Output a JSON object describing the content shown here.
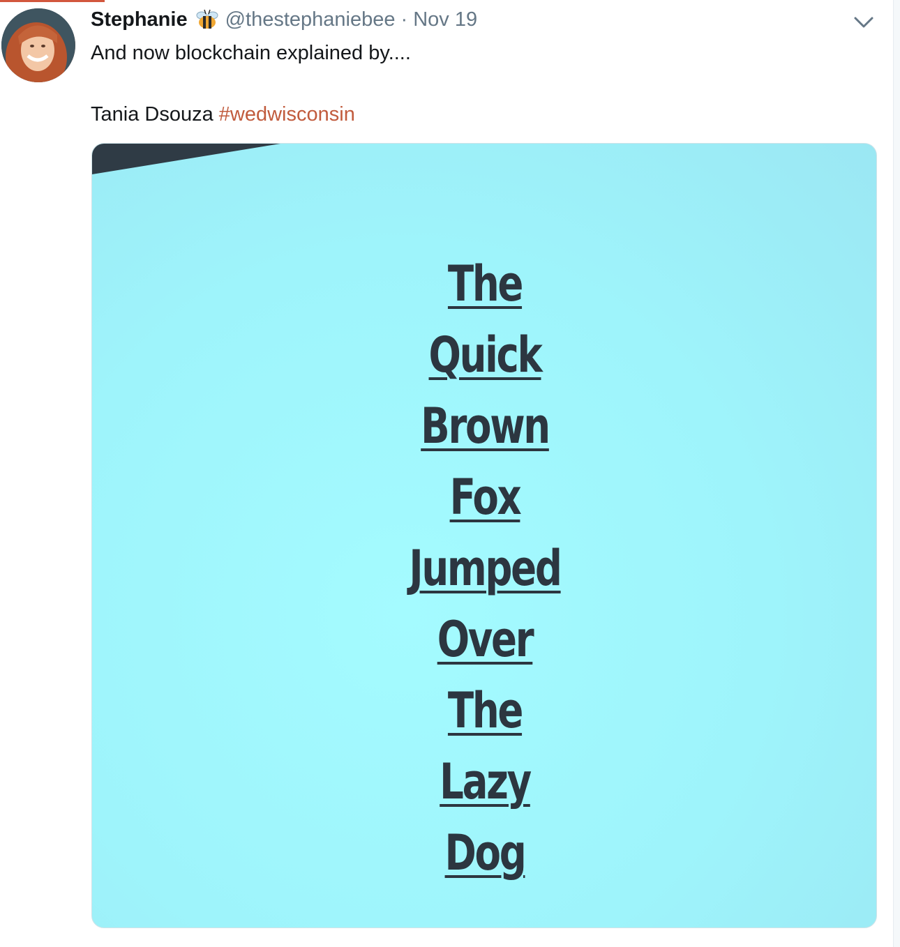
{
  "colors": {
    "text_primary": "#14171a",
    "text_secondary": "#657786",
    "hashtag": "#c15b3d",
    "slide_background": "#a2f6fc",
    "slide_text": "#2c3640"
  },
  "tweet": {
    "author": {
      "display_name": "Stephanie",
      "name_emoji": "bee-icon",
      "handle": "@thestephaniebee"
    },
    "separator": "·",
    "timestamp": "Nov 19",
    "menu_icon": "chevron-down-icon",
    "text_line1": "And now blockchain explained by....",
    "text_line2_plain": "Tania Dsouza ",
    "hashtag": "#wedwisconsin",
    "media": {
      "words": [
        "The",
        "Quick",
        "Brown",
        "Fox",
        "Jumped",
        "Over",
        "The",
        "Lazy",
        "Dog"
      ]
    }
  }
}
